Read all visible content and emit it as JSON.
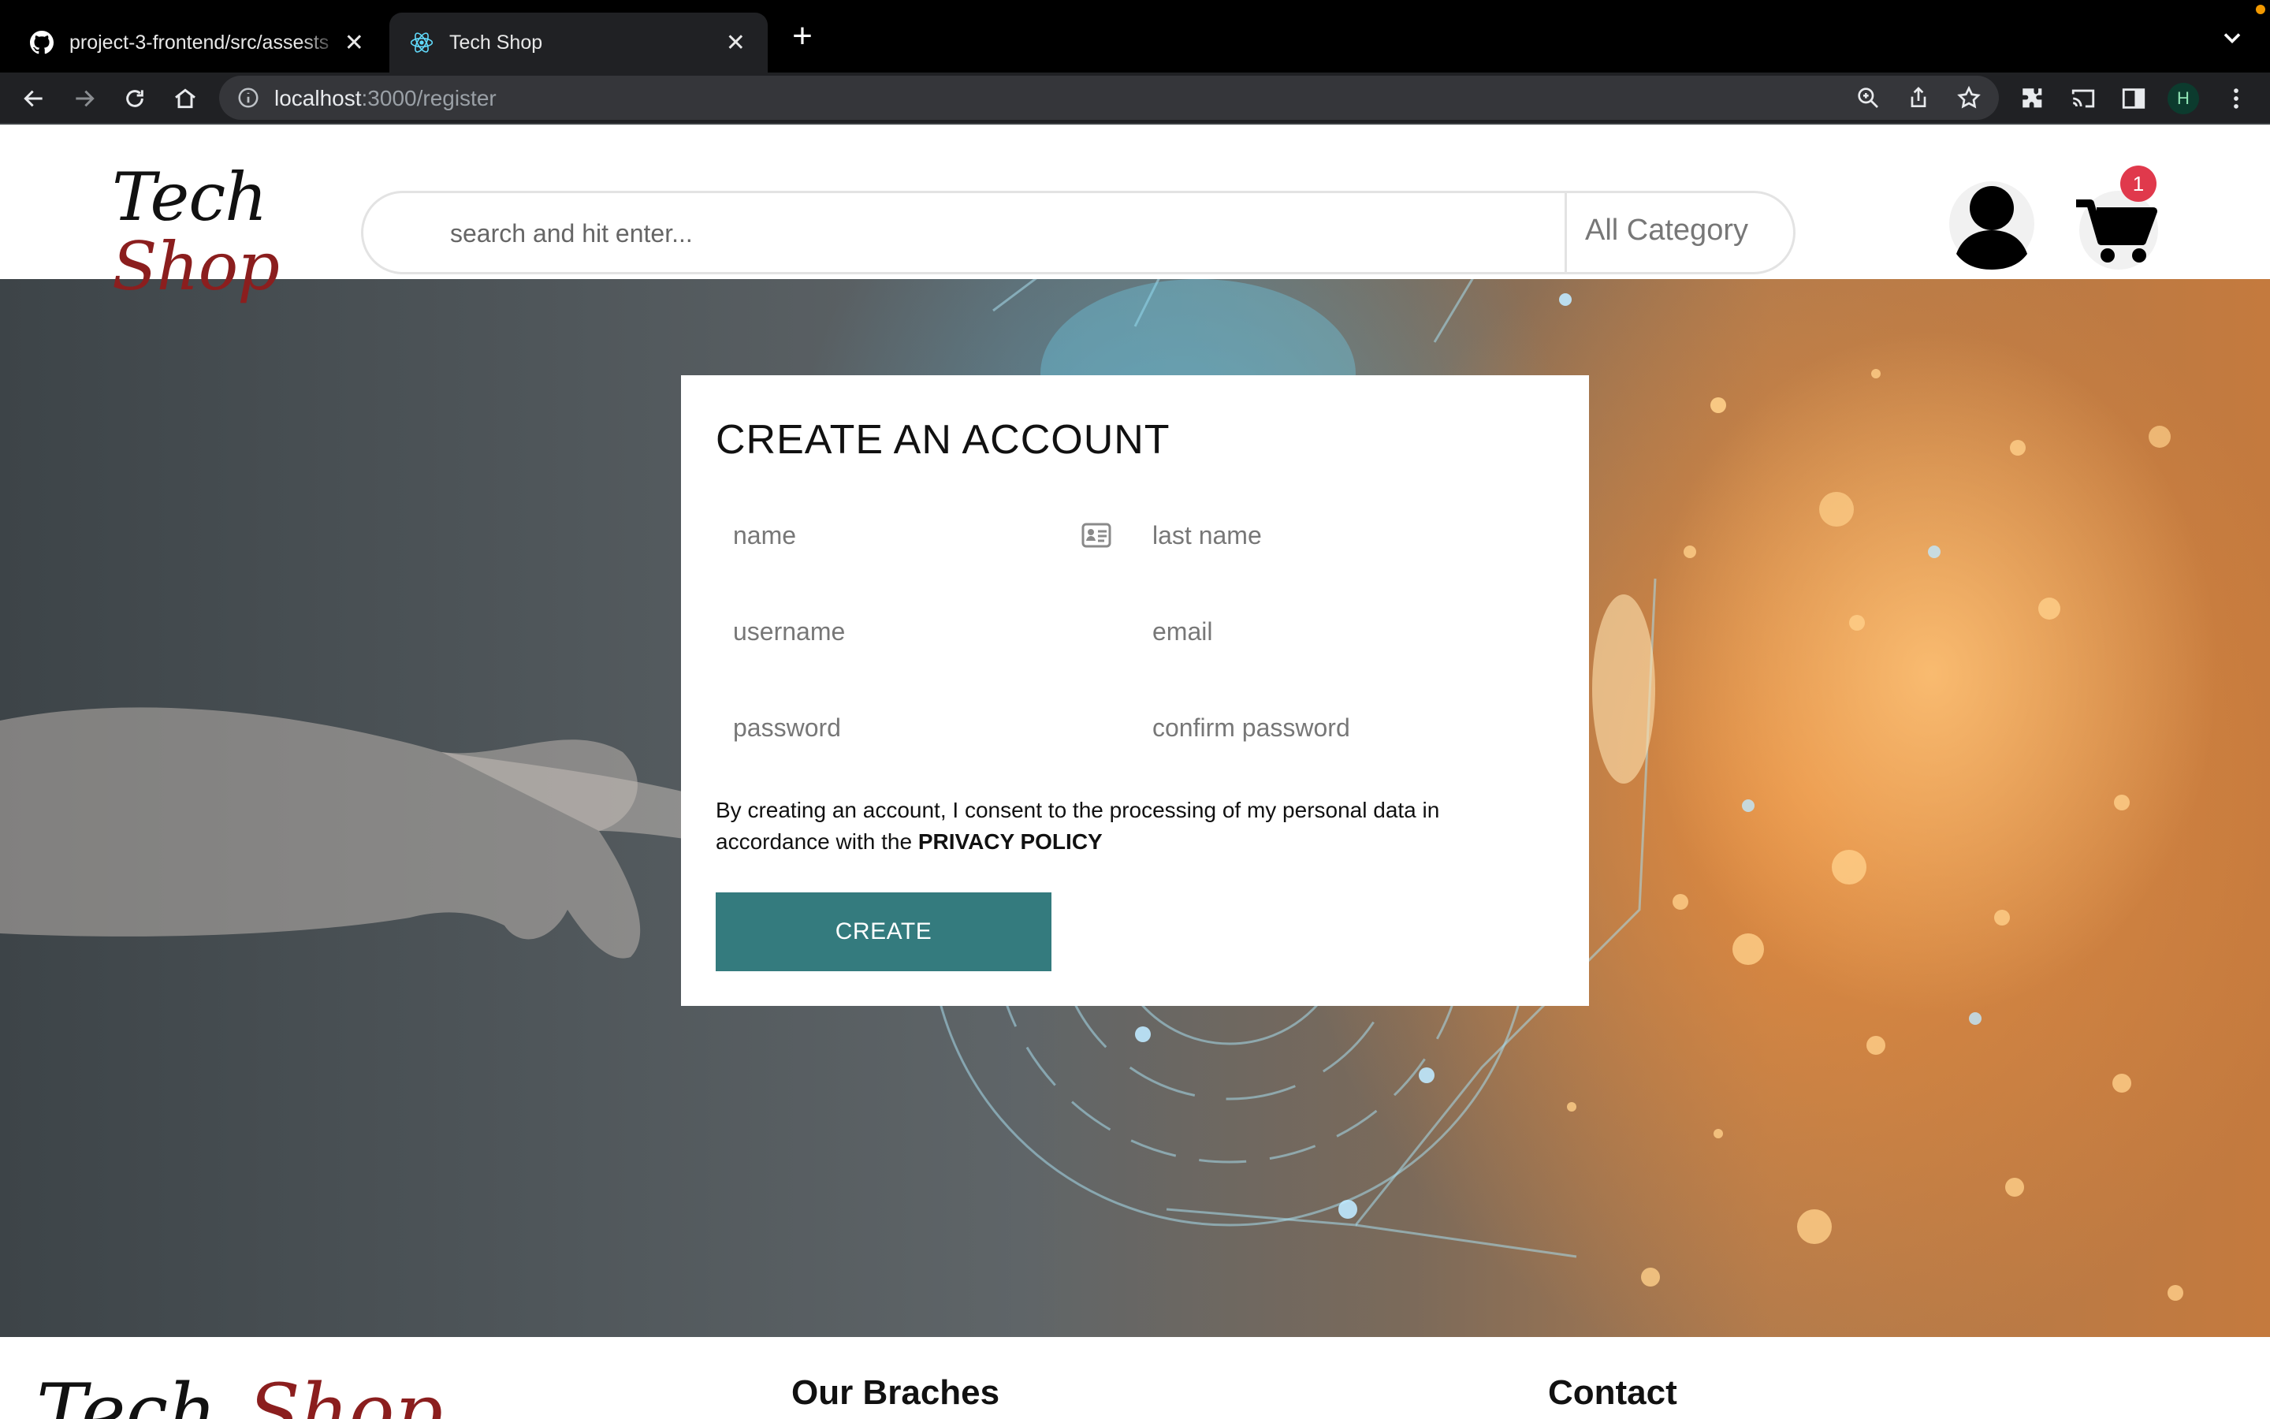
{
  "browser": {
    "tabs": [
      {
        "title": "project-3-frontend/src/assests",
        "icon": "github-icon",
        "active": false
      },
      {
        "title": "Tech Shop",
        "icon": "react-icon",
        "active": true
      }
    ],
    "url_host": "localhost",
    "url_path": ":3000/register",
    "profile_initial": "H",
    "colors": {
      "tabbar": "#000000",
      "toolbar": "#202124",
      "omnibox": "#35363a"
    }
  },
  "header": {
    "logo_line1": "Tech",
    "logo_line2": "Shop",
    "search_placeholder": "search and hit enter...",
    "category_label": "All Category",
    "cart_count": "1",
    "icons": [
      "user-icon",
      "cart-icon"
    ]
  },
  "register": {
    "title": "CREATE AN ACCOUNT",
    "placeholders": {
      "name": "name",
      "last_name": "last name",
      "username": "username",
      "email": "email",
      "password": "password",
      "confirm_password": "confirm password"
    },
    "agreement_text": "By creating an account, I consent to the processing of my personal data in accordance with the ",
    "agreement_link": "PRIVACY POLICY",
    "button_label": "CREATE",
    "colors": {
      "button": "#347b7e",
      "logo_accent": "#8b1e1e"
    }
  },
  "footer": {
    "logo_part1": "Tech",
    "logo_part2": "Shop",
    "branches_heading": "Our Braches",
    "contact_heading": "Contact"
  }
}
